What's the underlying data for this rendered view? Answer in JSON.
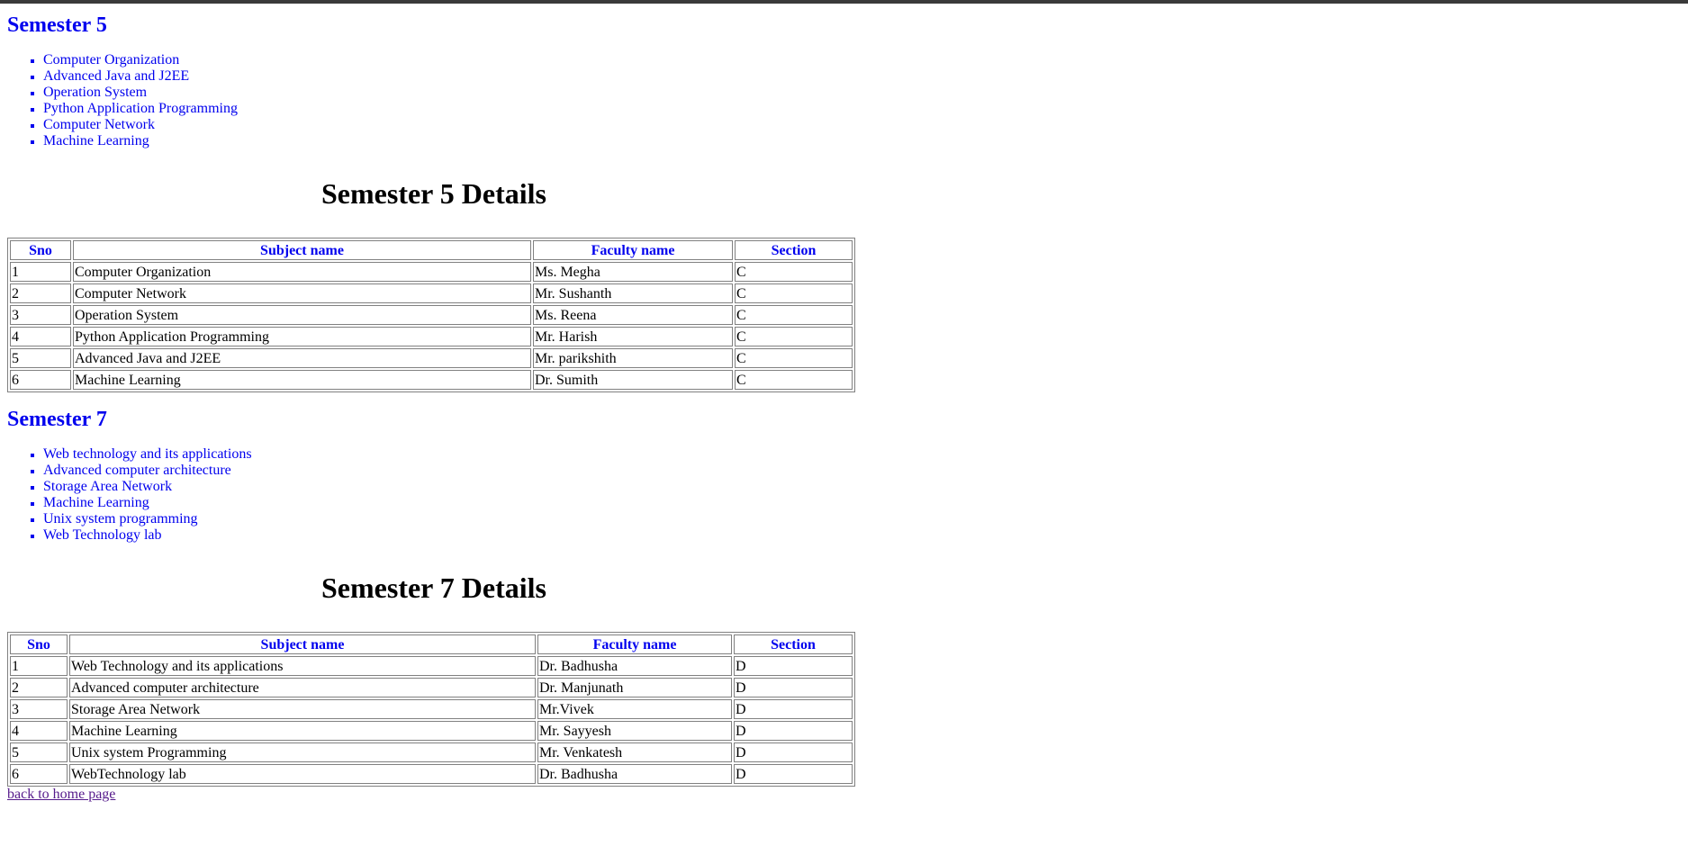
{
  "semester5": {
    "heading": "Semester 5",
    "subjects": [
      "Computer Organization",
      "Advanced Java and J2EE",
      "Operation System",
      "Python Application Programming",
      "Computer Network",
      "Machine Learning"
    ],
    "details_title": "Semester 5 Details",
    "table": {
      "headers": [
        "Sno",
        "Subject name",
        "Faculty name",
        "Section"
      ],
      "rows": [
        [
          "1",
          "Computer Organization",
          "Ms. Megha",
          "C"
        ],
        [
          "2",
          "Computer Network",
          "Mr. Sushanth",
          "C"
        ],
        [
          "3",
          "Operation System",
          "Ms. Reena",
          "C"
        ],
        [
          "4",
          "Python Application Programming",
          "Mr. Harish",
          "C"
        ],
        [
          "5",
          "Advanced Java and J2EE",
          "Mr. parikshith",
          "C"
        ],
        [
          "6",
          "Machine Learning",
          "Dr. Sumith",
          "C"
        ]
      ]
    }
  },
  "semester7": {
    "heading": "Semester 7",
    "subjects": [
      "Web technology and its applications",
      "Advanced computer architecture",
      "Storage Area Network",
      "Machine Learning",
      "Unix system programming",
      "Web Technology lab"
    ],
    "details_title": "Semester 7 Details",
    "table": {
      "headers": [
        "Sno",
        "Subject name",
        "Faculty name",
        "Section"
      ],
      "rows": [
        [
          "1",
          "Web Technology and its applications",
          "Dr. Badhusha",
          "D"
        ],
        [
          "2",
          "Advanced computer architecture",
          "Dr. Manjunath",
          "D"
        ],
        [
          "3",
          "Storage Area Network",
          "Mr.Vivek",
          "D"
        ],
        [
          "4",
          "Machine Learning",
          "Mr. Sayyesh",
          "D"
        ],
        [
          "5",
          "Unix system Programming",
          "Mr. Venkatesh",
          "D"
        ],
        [
          "6",
          "WebTechnology lab",
          "Dr. Badhusha",
          "D"
        ]
      ]
    }
  },
  "footer": {
    "back_link": "back to home page"
  },
  "colors": {
    "link": "#0000ee",
    "visited_link": "#551a8b",
    "border": "#808080"
  }
}
